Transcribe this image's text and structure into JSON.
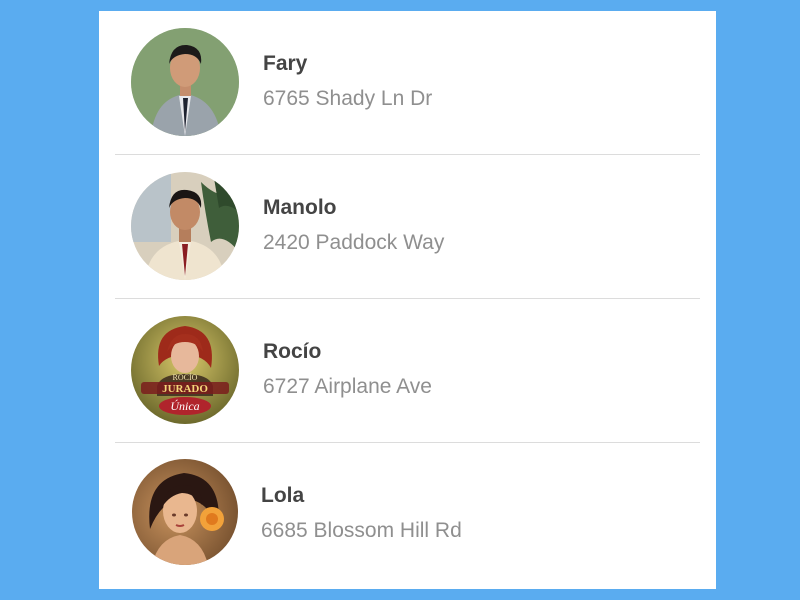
{
  "contacts": [
    {
      "name": "Fary",
      "address": "6765 Shady Ln Dr",
      "avatar": "photo-man-grey-suit"
    },
    {
      "name": "Manolo",
      "address": "2420 Paddock Way",
      "avatar": "photo-man-cream-suit"
    },
    {
      "name": "Rocío",
      "address": "6727 Airplane Ave",
      "avatar": "album-cover-rocio-jurado-unica"
    },
    {
      "name": "Lola",
      "address": "6685 Blossom Hill Rd",
      "avatar": "photo-woman-with-flower"
    }
  ],
  "album_cover_text": {
    "artist": "ROCÍO JURADO",
    "title": "Única"
  },
  "colors": {
    "background": "#5aacf0",
    "card": "#ffffff",
    "name": "#444444",
    "address": "#8f8f8f",
    "divider": "#dcdcdc"
  }
}
